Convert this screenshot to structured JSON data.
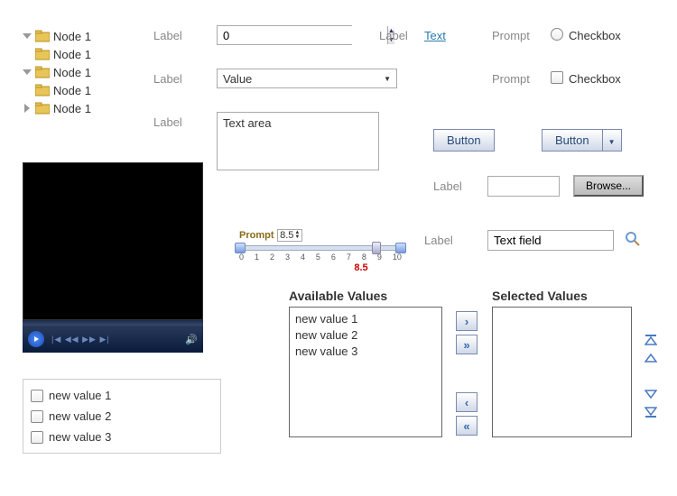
{
  "tree": {
    "nodes": [
      {
        "label": "Node 1",
        "state": "open",
        "indent": 0
      },
      {
        "label": "Node 1",
        "state": "none",
        "indent": 1
      },
      {
        "label": "Node 1",
        "state": "open",
        "indent": 0
      },
      {
        "label": "Node 1",
        "state": "none",
        "indent": 1
      },
      {
        "label": "Node 1",
        "state": "closed",
        "indent": 0
      }
    ]
  },
  "row1": {
    "label": "Label",
    "spinner_value": "0",
    "label2": "Label",
    "link": "Text",
    "prompt": "Prompt",
    "checkbox_label": "Checkbox"
  },
  "row2": {
    "label": "Label",
    "dropdown_value": "Value",
    "prompt": "Prompt",
    "checkbox_label": "Checkbox"
  },
  "row3": {
    "label": "Label",
    "textarea_value": "Text area"
  },
  "buttons": {
    "b1": "Button",
    "b2": "Button"
  },
  "browse": {
    "label": "Label",
    "btn": "Browse..."
  },
  "textfield": {
    "label": "Label",
    "value": "Text field"
  },
  "slider": {
    "prompt": "Prompt",
    "value": "8.5",
    "ticks": [
      "0",
      "1",
      "2",
      "3",
      "4",
      "5",
      "6",
      "7",
      "8",
      "9",
      "10"
    ],
    "indicator": "8.5"
  },
  "shuttle": {
    "avail_title": "Available Values",
    "sel_title": "Selected Values",
    "available": [
      "new value 1",
      "new value 2",
      "new value 3"
    ],
    "selected": []
  },
  "checklist": {
    "items": [
      "new value 1",
      "new value 2",
      "new value 3"
    ]
  }
}
